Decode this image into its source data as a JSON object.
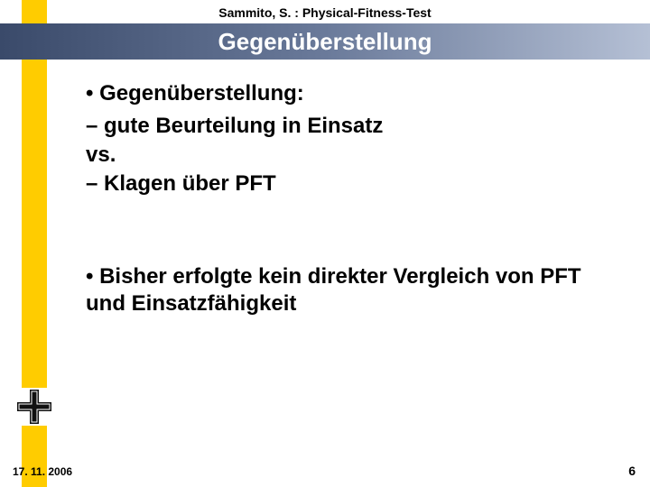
{
  "header": {
    "author_line": "Sammito, S. : Physical-Fitness-Test"
  },
  "title": "Gegenüberstellung",
  "bullets": {
    "b1": "• Gegenüberstellung:",
    "s1": "– gute Beurteilung in Einsatz",
    "vs": "vs.",
    "s2": "– Klagen über PFT",
    "b2": "• Bisher erfolgte kein direkter Vergleich von PFT und Einsatzfähigkeit"
  },
  "footer": {
    "date": "17. 11. 2006",
    "page": "6"
  },
  "logo_name": "bundeswehr-iron-cross"
}
